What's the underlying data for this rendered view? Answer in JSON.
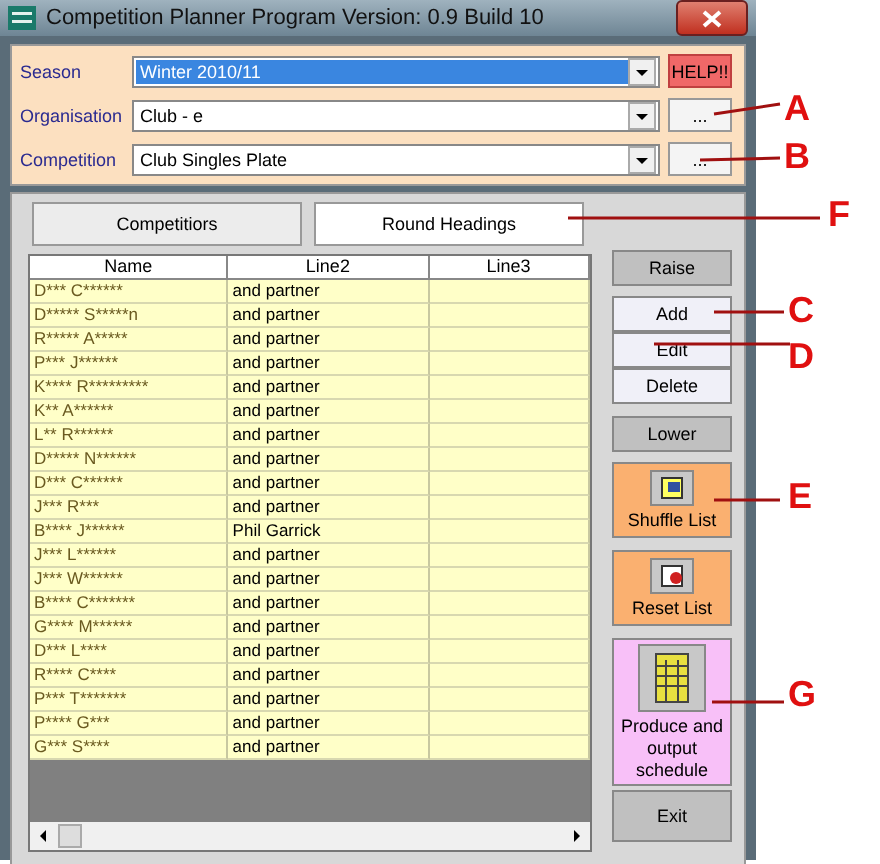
{
  "window": {
    "title": "Competition Planner Program Version: 0.9 Build 10"
  },
  "fields": [
    {
      "label": "Season",
      "value": "Winter 2010/11",
      "selected": true,
      "side": "HELP!!",
      "kind": "help"
    },
    {
      "label": "Organisation",
      "value": "Club - e",
      "selected": false,
      "side": "...",
      "kind": "more"
    },
    {
      "label": "Competition",
      "value": "Club Singles Plate",
      "selected": false,
      "side": "...",
      "kind": "more"
    }
  ],
  "tabs": [
    {
      "label": "Competitiors",
      "selected": false
    },
    {
      "label": "Round Headings",
      "selected": true
    }
  ],
  "table": {
    "columns": [
      "Name",
      "Line2",
      "Line3"
    ],
    "rows": [
      [
        "D*** C******",
        "and partner"
      ],
      [
        "D***** S*****n",
        "and partner"
      ],
      [
        "R***** A*****",
        "and partner"
      ],
      [
        "P*** J******",
        "and partner"
      ],
      [
        "K**** R*********",
        "and partner"
      ],
      [
        "K** A******",
        "and partner"
      ],
      [
        "L** R******",
        "and partner"
      ],
      [
        "D***** N******",
        "and partner"
      ],
      [
        "D*** C******",
        "and partner"
      ],
      [
        "J*** R***",
        "and partner"
      ],
      [
        "B**** J******",
        "Phil Garrick"
      ],
      [
        "J*** L******",
        "and partner"
      ],
      [
        "J*** W******",
        "and partner"
      ],
      [
        "B**** C*******",
        "and partner"
      ],
      [
        "G**** M******",
        "and partner"
      ],
      [
        "D*** L****",
        "and partner"
      ],
      [
        "R**** C****",
        "and partner"
      ],
      [
        "P*** T*******",
        "and partner"
      ],
      [
        "P**** G***",
        "and partner"
      ],
      [
        "G*** S****",
        "and partner"
      ]
    ]
  },
  "buttons": [
    {
      "label": "Raise",
      "kind": "grey"
    },
    {
      "label": "Add",
      "kind": "light"
    },
    {
      "label": "Edit",
      "kind": "light"
    },
    {
      "label": "Delete",
      "kind": "light"
    },
    {
      "label": "Lower",
      "kind": "grey"
    },
    {
      "label": "Shuffle List",
      "kind": "shuffle"
    },
    {
      "label": "Reset List",
      "kind": "reset"
    },
    {
      "label": "Produce and output schedule",
      "kind": "produce"
    },
    {
      "label": "Exit",
      "kind": "grey"
    }
  ],
  "callouts": [
    "A",
    "B",
    "F",
    "C",
    "D",
    "E",
    "G"
  ]
}
